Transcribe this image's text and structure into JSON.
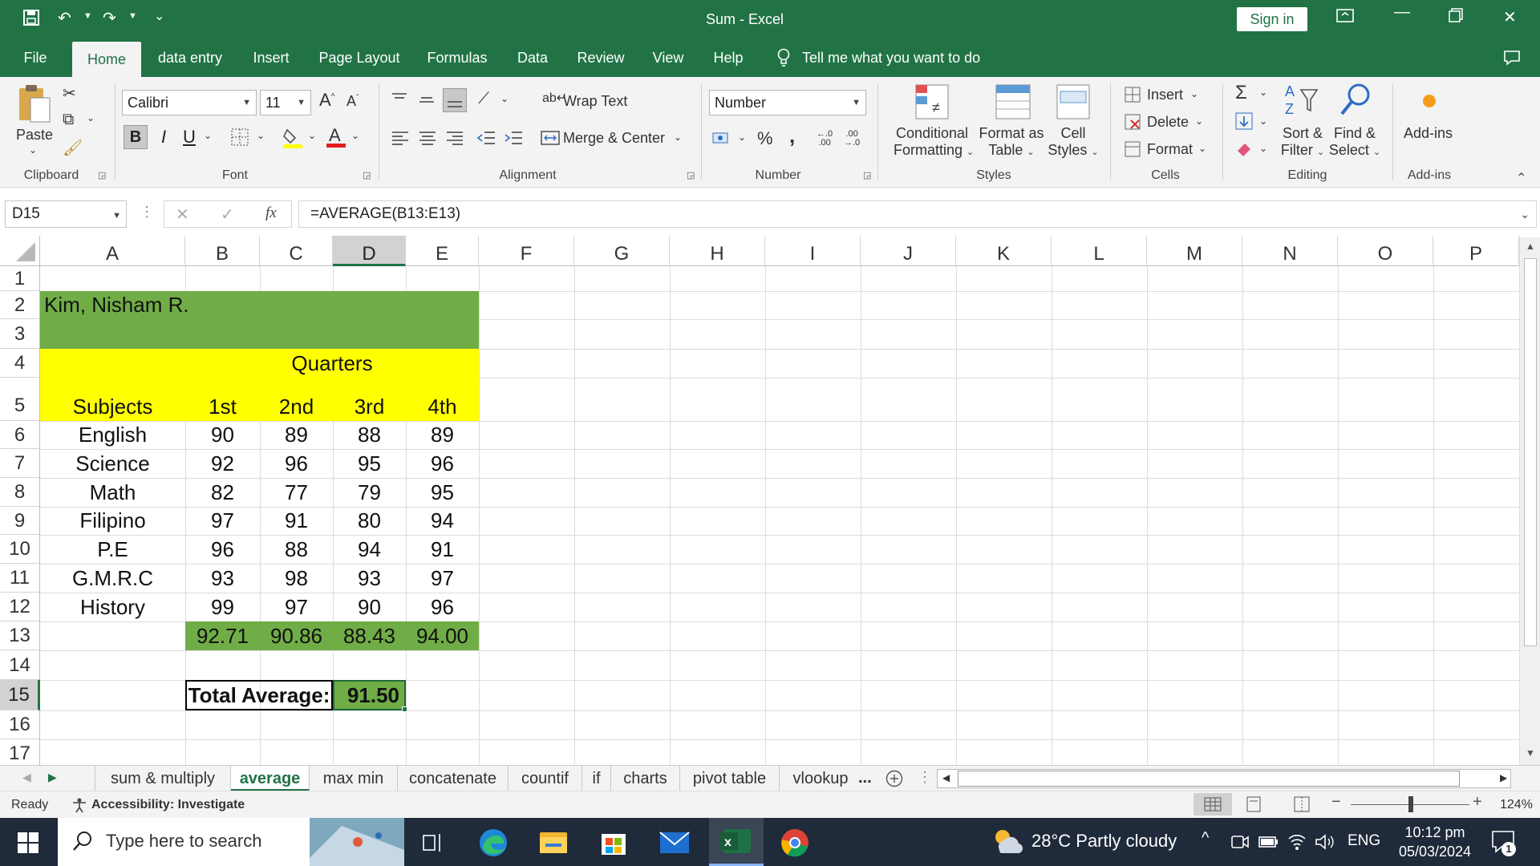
{
  "window": {
    "title": "Sum  -  Excel",
    "sign_in": "Sign in"
  },
  "tabs": [
    "File",
    "Home",
    "data entry",
    "Insert",
    "Page Layout",
    "Formulas",
    "Data",
    "Review",
    "View",
    "Help"
  ],
  "tell_me": "Tell me what you want to do",
  "ribbon": {
    "clipboard": {
      "paste": "Paste",
      "label": "Clipboard"
    },
    "font": {
      "name": "Calibri",
      "size": "11",
      "label": "Font",
      "bold": "B",
      "italic": "I",
      "underline": "U"
    },
    "alignment": {
      "wrap": "Wrap Text",
      "merge": "Merge & Center",
      "label": "Alignment"
    },
    "number": {
      "format": "Number",
      "label": "Number",
      "percent": "%",
      "comma": ","
    },
    "styles": {
      "conditional_1": "Conditional",
      "conditional_2": "Formatting",
      "format_table_1": "Format as",
      "format_table_2": "Table",
      "cell_styles_1": "Cell",
      "cell_styles_2": "Styles",
      "label": "Styles"
    },
    "cells": {
      "insert": "Insert",
      "delete": "Delete",
      "format": "Format",
      "label": "Cells"
    },
    "editing": {
      "sort_1": "Sort &",
      "sort_2": "Filter",
      "find_1": "Find &",
      "find_2": "Select",
      "label": "Editing"
    },
    "addins": {
      "btn": "Add-ins",
      "label": "Add-ins"
    }
  },
  "formula_bar": {
    "name_box": "D15",
    "fx": "fx",
    "formula": "=AVERAGE(B13:E13)"
  },
  "columns": [
    "A",
    "B",
    "C",
    "D",
    "E",
    "F",
    "G",
    "H",
    "I",
    "J",
    "K",
    "L",
    "M",
    "N",
    "O",
    "P"
  ],
  "rows": [
    "1",
    "2",
    "3",
    "4",
    "5",
    "6",
    "7",
    "8",
    "9",
    "10",
    "11",
    "12",
    "13",
    "14",
    "15",
    "16",
    "17"
  ],
  "sheet": {
    "name": "Kim, Nisham R.",
    "quarters": "Quarters",
    "headers": [
      "Subjects",
      "1st",
      "2nd",
      "3rd",
      "4th"
    ],
    "data": [
      [
        "English",
        "90",
        "89",
        "88",
        "89"
      ],
      [
        "Science",
        "92",
        "96",
        "95",
        "96"
      ],
      [
        "Math",
        "82",
        "77",
        "79",
        "95"
      ],
      [
        "Filipino",
        "97",
        "91",
        "80",
        "94"
      ],
      [
        "P.E",
        "96",
        "88",
        "94",
        "91"
      ],
      [
        "G.M.R.C",
        "93",
        "98",
        "93",
        "97"
      ],
      [
        "History",
        "99",
        "97",
        "90",
        "96"
      ]
    ],
    "averages": [
      "92.71",
      "90.86",
      "88.43",
      "94.00"
    ],
    "total_label": "Total Average:",
    "total_value": "91.50"
  },
  "sheet_tabs": [
    "sum & multiply",
    "average",
    "max min",
    "concatenate",
    "countif",
    "if",
    "charts",
    "pivot table",
    "vlookup"
  ],
  "sheet_more": "...",
  "status": {
    "ready": "Ready",
    "accessibility": "Accessibility: Investigate",
    "zoom": "124%"
  },
  "taskbar": {
    "search": "Type here to search",
    "weather": "28°C  Partly cloudy",
    "lang": "ENG",
    "time": "10:12 pm",
    "date": "05/03/2024",
    "notif": "1"
  },
  "colors": {
    "excel_green": "#217346",
    "green_fill": "#70ad47",
    "yellow_fill": "#ffff00"
  }
}
